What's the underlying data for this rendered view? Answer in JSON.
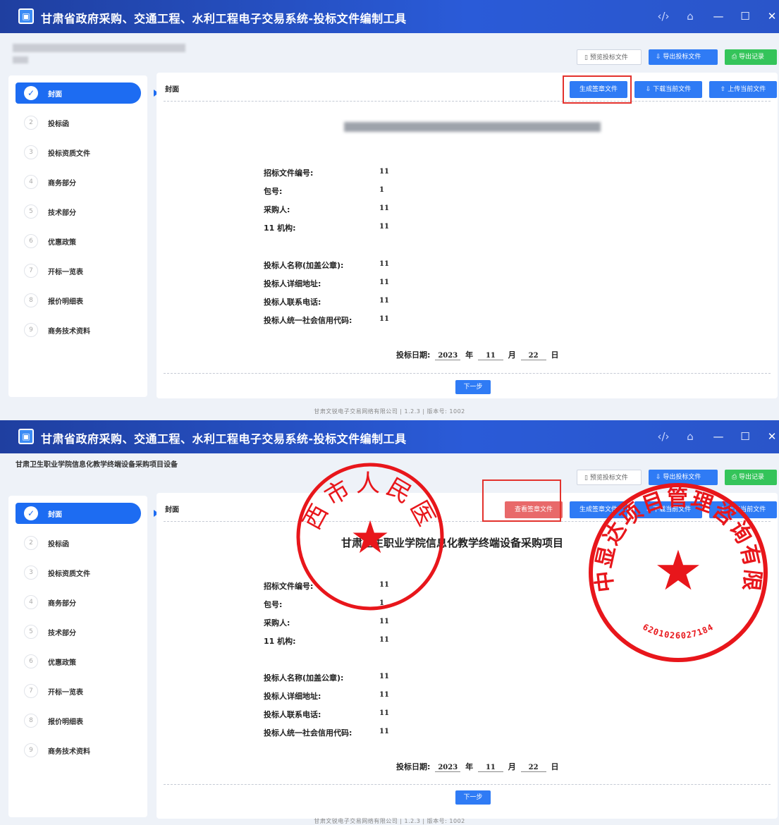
{
  "app": {
    "title": "甘肃省政府采购、交通工程、水利工程电子交易系统-投标文件编制工具",
    "logo_glyph": "▣"
  },
  "window_controls": {
    "code": "‹/›",
    "home": "⌂",
    "minimize": "—",
    "maximize": "☐",
    "close": "✕"
  },
  "toolbar": {
    "preview": "▯ 预览投标文件",
    "export_doc": "⇩ 导出投标文件",
    "export_record": "⎙ 导出记录"
  },
  "steps": [
    {
      "num": "✓",
      "label": "封面"
    },
    {
      "num": "2",
      "label": "投标函"
    },
    {
      "num": "3",
      "label": "投标资质文件"
    },
    {
      "num": "4",
      "label": "商务部分"
    },
    {
      "num": "5",
      "label": "技术部分"
    },
    {
      "num": "6",
      "label": "优惠政策"
    },
    {
      "num": "7",
      "label": "开标一览表"
    },
    {
      "num": "8",
      "label": "报价明细表"
    },
    {
      "num": "9",
      "label": "商务技术资料"
    }
  ],
  "section_title": "封面",
  "actions": {
    "generate_sign": "生成签章文件",
    "view_sign": "查看签章文件",
    "download_current": "⇩ 下载当前文件",
    "upload_current": "⇧ 上传当前文件"
  },
  "fields": [
    {
      "label": "招标文件编号:",
      "value": "11"
    },
    {
      "label": "包号:",
      "value": "1"
    },
    {
      "label": "采购人:",
      "value": "11"
    },
    {
      "label": "11 机构:",
      "value": "11"
    },
    {
      "label": "投标人名称(加盖公章):",
      "value": "11"
    },
    {
      "label": "投标人详细地址:",
      "value": "11"
    },
    {
      "label": "投标人联系电话:",
      "value": "11"
    },
    {
      "label": "投标人统一社会信用代码:",
      "value": "11"
    }
  ],
  "date": {
    "label": "投标日期:",
    "year": "2023",
    "year_unit": "年",
    "month": "11",
    "month_unit": "月",
    "day": "22",
    "day_unit": "日"
  },
  "next_button": "下一步",
  "footer": "甘肃文锐电子交易网络有限公司 | 1.2.3 | 版本号: 1002",
  "screen2": {
    "project_name": "甘肃卫生职业学院信息化教学终端设备采购项目设备",
    "doc_title": "甘肃卫生职业学院信息化教学终端设备采购项目"
  },
  "stamps": {
    "left": {
      "text": "定西市人民医院",
      "star": "★"
    },
    "right": {
      "text": "甘肃中显达项目管理咨询有限公司",
      "code": "6201026027184",
      "star": "★"
    }
  },
  "colors": {
    "titlebar": "#2a55c9",
    "primary": "#1d6cf2",
    "success": "#34c45a",
    "view_sign": "#e8696a",
    "stamp": "#e8161b",
    "highlight": "#e3322d"
  }
}
